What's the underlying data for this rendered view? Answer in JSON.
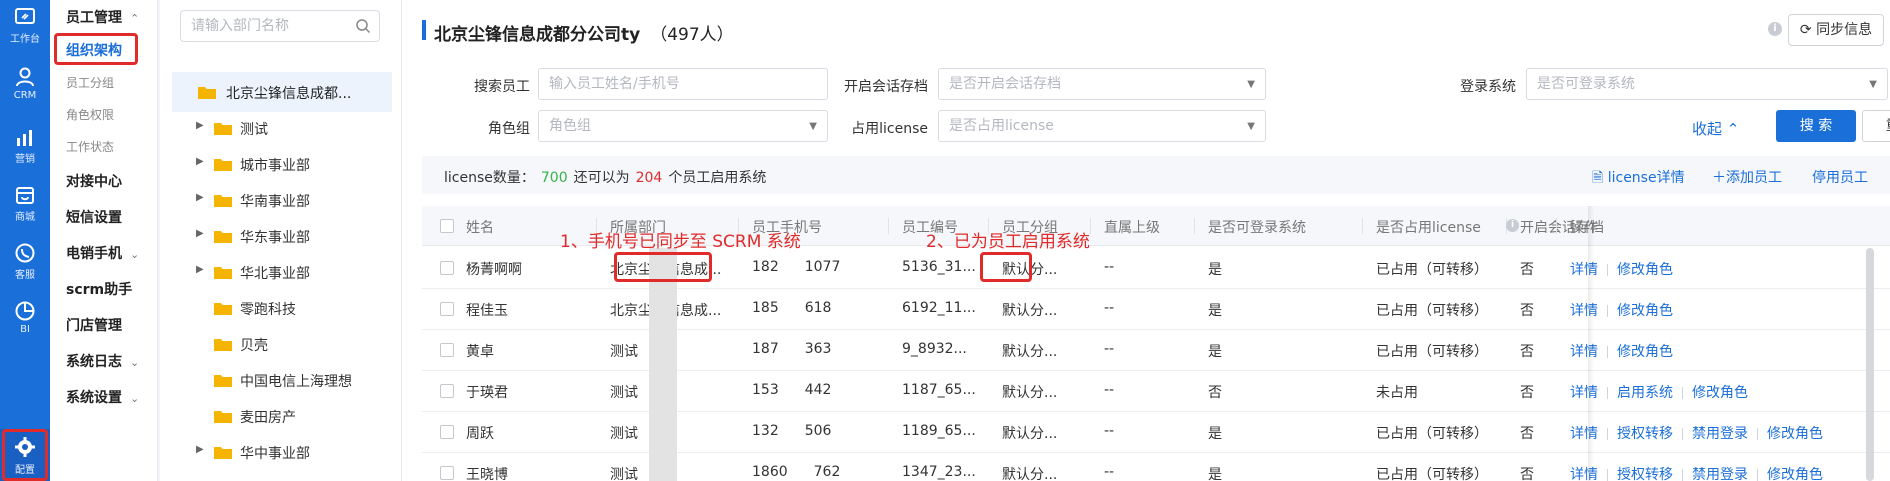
{
  "rail": {
    "items": [
      {
        "label": "工作台",
        "icon": "workbench-icon"
      },
      {
        "label": "CRM",
        "icon": "user-icon"
      },
      {
        "label": "营销",
        "icon": "chart-bars-icon"
      },
      {
        "label": "商城",
        "icon": "store-icon"
      },
      {
        "label": "客服",
        "icon": "phone-chat-icon"
      },
      {
        "label": "BI",
        "icon": "pie-chart-icon"
      },
      {
        "label": "配置",
        "icon": "gear-icon"
      }
    ]
  },
  "menu": {
    "group_title": "员工管理",
    "subs": [
      "组织架构",
      "员工分组",
      "角色权限",
      "工作状态"
    ],
    "items": [
      "对接中心",
      "短信设置",
      "电销手机",
      "scrm助手",
      "门店管理",
      "系统日志",
      "系统设置"
    ]
  },
  "tree": {
    "search_placeholder": "请输入部门名称",
    "root": "北京尘锋信息成都...",
    "nodes": [
      "测试",
      "城市事业部",
      "华南事业部",
      "华东事业部",
      "华北事业部",
      "零跑科技",
      "贝壳",
      "中国电信上海理想",
      "麦田房产",
      "华中事业部"
    ]
  },
  "header": {
    "title": "北京尘锋信息成都分公司ty",
    "count": "（497人）",
    "sync_label": "同步信息"
  },
  "filters": {
    "employee_label": "搜索员工",
    "employee_placeholder": "输入员工姓名/手机号",
    "archive_label": "开启会话存档",
    "archive_placeholder": "是否开启会话存档",
    "login_label": "登录系统",
    "login_placeholder": "是否可登录系统",
    "role_label": "角色组",
    "role_placeholder": "角色组",
    "license_label": "占用license",
    "license_placeholder": "是否占用license",
    "collapse_label": "收起",
    "search_label": "搜 索",
    "reset_label": "重 置"
  },
  "license": {
    "count_label": "license数量：",
    "count": "700",
    "mid_text": "还可以为",
    "remaining": "204",
    "tail_text": "个员工启用系统",
    "detail_link": "license详情",
    "add_link": "添加员工",
    "disable_link": "停用员工"
  },
  "table": {
    "columns": [
      "姓名",
      "所属部门",
      "员工手机号",
      "员工编号",
      "员工分组",
      "直属上级",
      "是否可登录系统",
      "是否占用license",
      "开启会话存档",
      "操作"
    ],
    "rows": [
      {
        "name": "杨菁啊啊",
        "dept": "北京尘锋信息成...",
        "phone_a": "182",
        "phone_b": "1077",
        "code": "5136_31...",
        "group": "默认分...",
        "leader": "--",
        "login": "是",
        "license": "已占用（可转移）",
        "archive": "否",
        "ops": [
          "详情",
          "修改角色"
        ]
      },
      {
        "name": "程佳玉",
        "dept": "北京尘锋信息成...",
        "phone_a": "185",
        "phone_b": "618",
        "code": "6192_11...",
        "group": "默认分...",
        "leader": "--",
        "login": "是",
        "license": "已占用（可转移）",
        "archive": "否",
        "ops": [
          "详情",
          "修改角色"
        ]
      },
      {
        "name": "黄卓",
        "dept": "测试",
        "phone_a": "187",
        "phone_b": "363",
        "code": "9_8932...",
        "group": "默认分...",
        "leader": "--",
        "login": "是",
        "license": "已占用（可转移）",
        "archive": "否",
        "ops": [
          "详情",
          "修改角色"
        ]
      },
      {
        "name": "于瑛君",
        "dept": "测试",
        "phone_a": "153",
        "phone_b": "442",
        "code": "1187_65...",
        "group": "默认分...",
        "leader": "--",
        "login": "否",
        "license": "未占用",
        "archive": "否",
        "ops": [
          "详情",
          "启用系统",
          "修改角色"
        ]
      },
      {
        "name": "周跃",
        "dept": "测试",
        "phone_a": "132",
        "phone_b": "506",
        "code": "1189_65...",
        "group": "默认分...",
        "leader": "--",
        "login": "是",
        "license": "已占用（可转移）",
        "archive": "否",
        "ops": [
          "详情",
          "授权转移",
          "禁用登录",
          "修改角色"
        ]
      },
      {
        "name": "王晓博",
        "dept": "测试",
        "phone_a": "1860",
        "phone_b": "762",
        "code": "1347_23...",
        "group": "默认分...",
        "leader": "--",
        "login": "是",
        "license": "已占用（可转移）",
        "archive": "否",
        "ops": [
          "详情",
          "授权转移",
          "禁用登录",
          "修改角色"
        ]
      }
    ]
  },
  "annotations": {
    "phone": "1、手机号已同步至 SCRM 系统",
    "login": "2、已为员工启用系统"
  },
  "colors": {
    "brand": "#1b6fd9",
    "annotation": "#e02b2b",
    "license_count": "#34b34a",
    "license_remaining": "#e02b2b"
  }
}
